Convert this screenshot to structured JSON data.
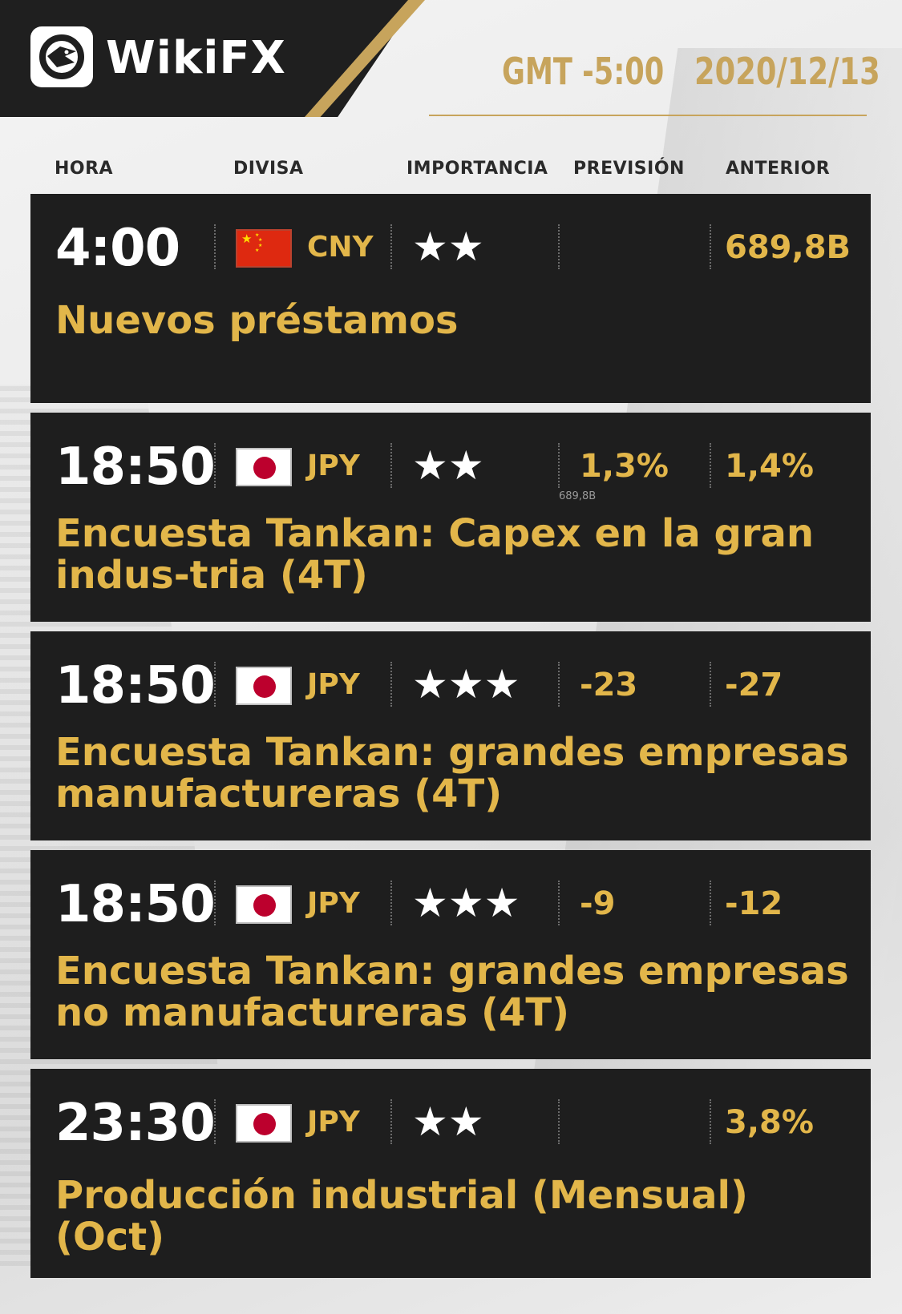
{
  "brand": {
    "name": "WikiFX",
    "logo_icon": "eagle-logo-icon"
  },
  "timezone": "GMT -5:00",
  "date": "2020/12/13",
  "colors": {
    "gold": "#c7a45c",
    "value_gold": "#e2b64a",
    "row_bg": "#1e1e1e"
  },
  "columns": {
    "hora": "HORA",
    "divisa": "DIVISA",
    "importancia": "IMPORTANCIA",
    "prevision": "PREVISIÓN",
    "anterior": "ANTERIOR"
  },
  "events": [
    {
      "time": "4:00",
      "flag": "china-flag-icon",
      "currency": "CNY",
      "importance": 2,
      "stars": "★★",
      "forecast": "",
      "previous": "689,8B",
      "name": "Nuevos préstamos"
    },
    {
      "time": "18:50",
      "flag": "japan-flag-icon",
      "currency": "JPY",
      "importance": 2,
      "stars": "★★",
      "forecast": "1,3%",
      "previous": "1,4%",
      "name": "Encuesta Tankan: Capex en la gran indus-tria (4T)",
      "stray_label": "689,8B"
    },
    {
      "time": "18:50",
      "flag": "japan-flag-icon",
      "currency": "JPY",
      "importance": 3,
      "stars": "★★★",
      "forecast": "-23",
      "previous": "-27",
      "name": "Encuesta Tankan: grandes empresas manufactureras (4T)"
    },
    {
      "time": "18:50",
      "flag": "japan-flag-icon",
      "currency": "JPY",
      "importance": 3,
      "stars": "★★★",
      "forecast": "-9",
      "previous": "-12",
      "name": "Encuesta Tankan: grandes empresas no manufactureras (4T)"
    },
    {
      "time": "23:30",
      "flag": "japan-flag-icon",
      "currency": "JPY",
      "importance": 2,
      "stars": "★★",
      "forecast": "",
      "previous": "3,8%",
      "name": "Producción industrial (Mensual) (Oct)"
    }
  ]
}
